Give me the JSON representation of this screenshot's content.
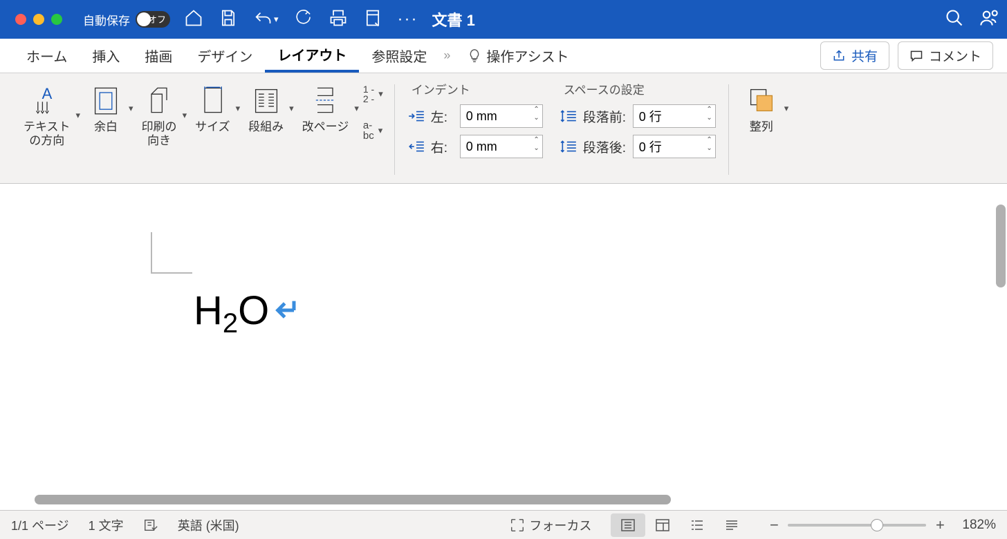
{
  "titlebar": {
    "autosave_label": "自動保存",
    "autosave_state": "オフ",
    "doc_title": "文書 1"
  },
  "tabs": {
    "home": "ホーム",
    "insert": "挿入",
    "draw": "描画",
    "design": "デザイン",
    "layout": "レイアウト",
    "references": "参照設定",
    "more_chevron": "»",
    "assist": "操作アシスト"
  },
  "ribbon_right": {
    "share": "共有",
    "comment": "コメント"
  },
  "ribbon": {
    "text_direction": "テキスト\nの方向",
    "margins": "余白",
    "orientation": "印刷の\n向き",
    "size": "サイズ",
    "columns": "段組み",
    "breaks": "改ページ",
    "line_numbers": "1 -\n2 -",
    "hyphen": "a-\nbc",
    "indent_title": "インデント",
    "indent_left_label": "左:",
    "indent_left_value": "0 mm",
    "indent_right_label": "右:",
    "indent_right_value": "0 mm",
    "spacing_title": "スペースの設定",
    "spacing_before_label": "段落前:",
    "spacing_before_value": "0 行",
    "spacing_after_label": "段落後:",
    "spacing_after_value": "0 行",
    "arrange": "整列"
  },
  "document": {
    "text_h": "H",
    "text_sub2": "2",
    "text_o": "O"
  },
  "statusbar": {
    "page": "1/1 ページ",
    "chars": "1 文字",
    "language": "英語 (米国)",
    "focus": "フォーカス",
    "zoom": "182%"
  }
}
